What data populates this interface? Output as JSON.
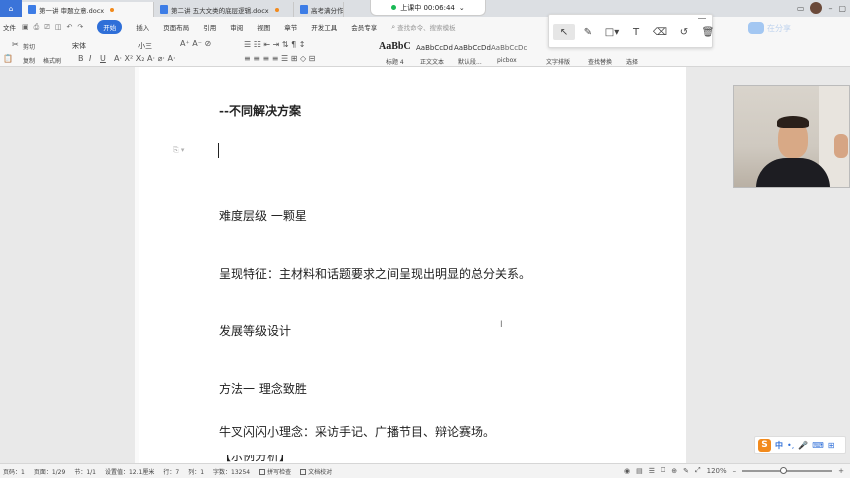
{
  "tabs": [
    {
      "label": "第一讲 审题立意.docx",
      "dirty": true
    },
    {
      "label": "第二讲 五大文类的底层逻辑.docx",
      "dirty": true
    },
    {
      "label": "高考满分作",
      "dirty": false
    }
  ],
  "live": {
    "status": "上课中 00:06:44",
    "chevron": "⌄"
  },
  "menu": {
    "file": "文件",
    "items": [
      "开始",
      "插入",
      "页面布局",
      "引用",
      "审阅",
      "视图",
      "章节",
      "开发工具",
      "会员专享"
    ],
    "search_placeholder": "查找命令、搜索模板"
  },
  "ribbon": {
    "cut": "剪切",
    "copy": "复制",
    "format_painter": "格式刷",
    "font_name": "宋体",
    "font_size": "小三",
    "styles": [
      {
        "preview": "AaBbC",
        "name": "标题 4"
      },
      {
        "preview": "AaBbCcDd",
        "name": "正文文本"
      },
      {
        "preview": "AaBbCcDd",
        "name": "默认段..."
      },
      {
        "preview": "AaBbCcDc",
        "name": "picbox"
      }
    ],
    "text_layout": "文字排版",
    "find_replace": "查找替换",
    "select": "选择"
  },
  "annotation_tools": [
    "select-arrow",
    "pen",
    "rectangle",
    "text",
    "eraser",
    "undo",
    "trash"
  ],
  "brand": {
    "text": "在分享"
  },
  "document": {
    "lines": [
      {
        "text": "--不同解决方案",
        "bold": true
      },
      {
        "text": "难度层级  一颗星",
        "bold": false
      },
      {
        "text": "呈现特征：主材料和话题要求之间呈现出明显的总分关系。",
        "bold": false
      },
      {
        "text": "发展等级设计",
        "bold": false
      },
      {
        "text": "方法一  理念致胜",
        "bold": false
      },
      {
        "text": "牛叉闪闪小理念：采访手记、广播节目、辩论赛场。",
        "bold": false
      }
    ],
    "cut_line": "【示例分析】"
  },
  "ime": {
    "label": "中"
  },
  "status": {
    "page_num": "页码：1",
    "page": "页面：1/29",
    "section": "节：1/1",
    "position": "设置值：12.1厘米",
    "row": "行：7",
    "col": "列：1",
    "word_count": "字数：13254",
    "spell_check": "拼写检查",
    "doc_proof": "文档校对",
    "zoom": "120%"
  },
  "colors": {
    "accent": "#2f6fd8",
    "live_dot": "#19b955",
    "ime_orange": "#f28a1c"
  }
}
